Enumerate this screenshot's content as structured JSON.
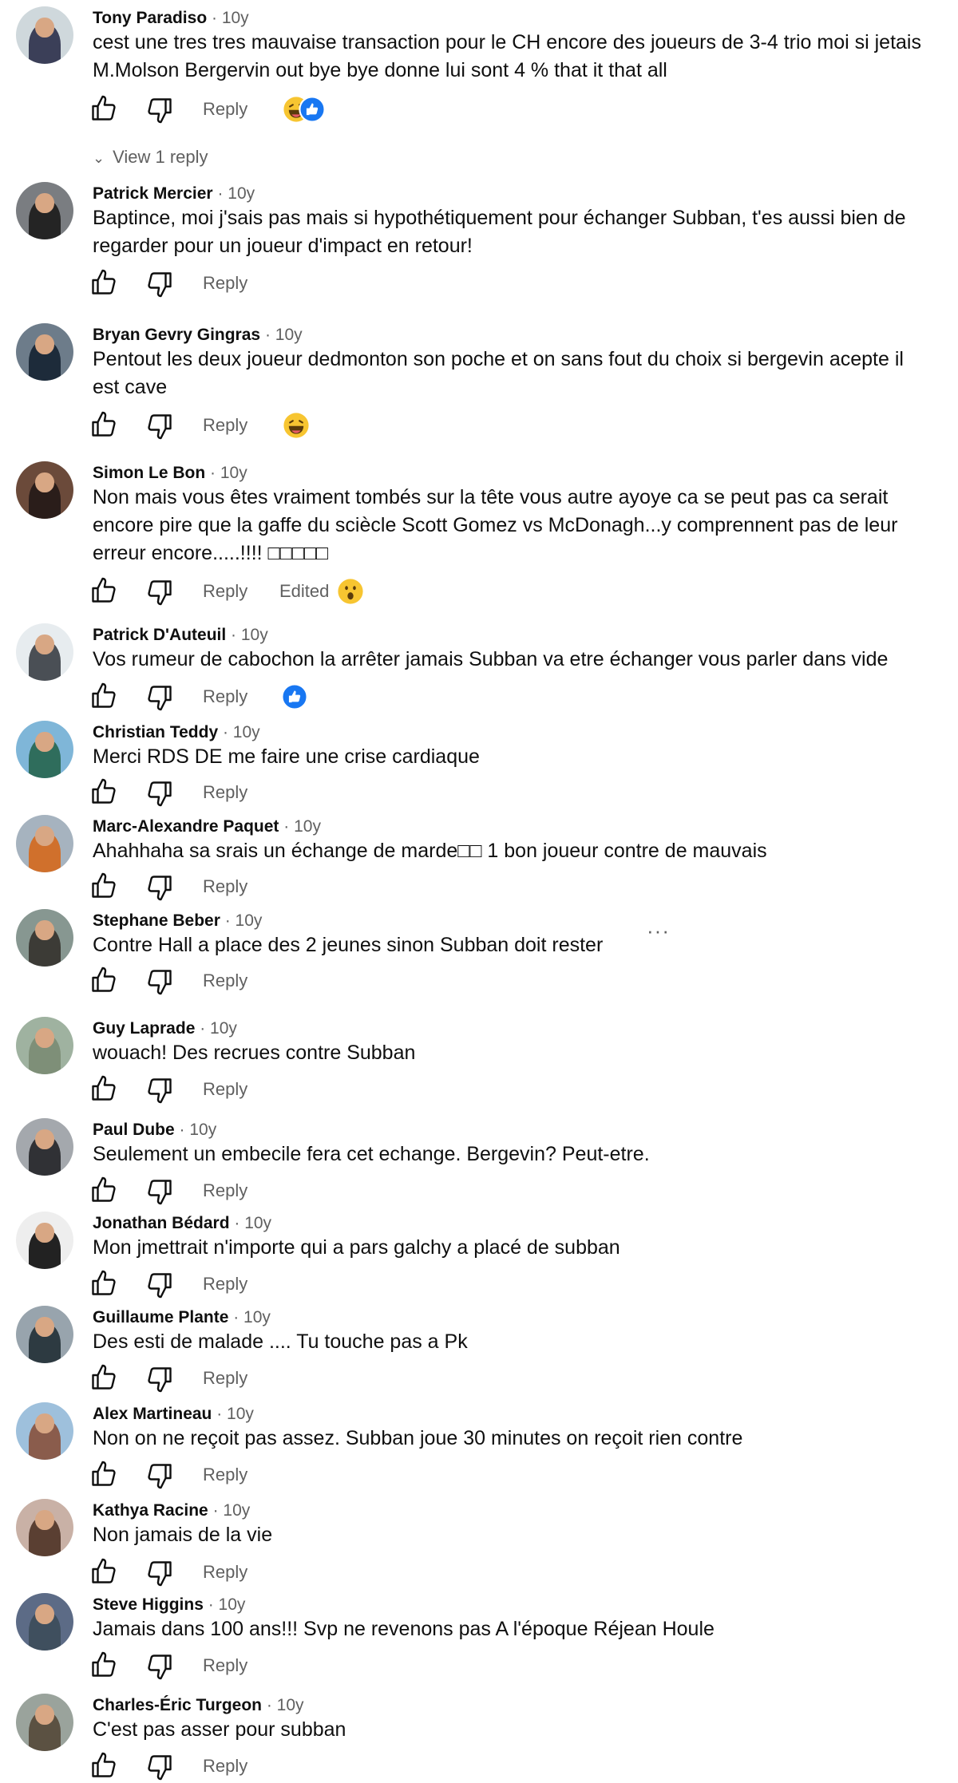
{
  "reply_label": "Reply",
  "comments": [
    {
      "author": "Tony Paradiso",
      "time": "· 10y",
      "text": "cest une tres tres mauvaise transaction pour le CH encore des joueurs de 3-4 trio moi si jetais M.Molson Bergervin out bye bye donne lui sont 4 % that it that all",
      "reactions": [
        "laugh-emoji",
        "like-badge"
      ],
      "view_replies": "View 1 reply"
    },
    {
      "author": "Patrick Mercier",
      "time": "· 10y",
      "text": "Baptince, moi j'sais pas mais si hypothétiquement pour échanger Subban, t'es aussi bien de regarder pour un joueur d'impact en retour!"
    },
    {
      "author": "Bryan Gevry Gingras",
      "time": "· 10y",
      "text": "Pentout les deux joueur dedmonton son poche et on sans fout du choix si bergevin acepte il est cave",
      "reactions": [
        "laugh-emoji"
      ]
    },
    {
      "author": "Simon Le Bon",
      "time": "· 10y",
      "text": "Non mais vous êtes vraiment tombés sur la tête vous autre ayoye ca se peut pas ca serait encore pire que la gaffe du sciècle Scott Gomez vs McDonagh...y comprennent pas de leur erreur encore.....!!!! □□□□□",
      "edited": "Edited",
      "reactions": [
        "wow-emoji"
      ]
    },
    {
      "author": "Patrick D'Auteuil",
      "time": "· 10y",
      "text": "Vos rumeur de cabochon la arrêter jamais Subban va etre échanger vous parler dans vide",
      "reactions": [
        "like-badge"
      ]
    },
    {
      "author": "Christian Teddy",
      "time": "· 10y",
      "text": "Merci RDS DE me faire une crise cardiaque"
    },
    {
      "author": "Marc-Alexandre Paquet",
      "time": "· 10y",
      "text": "Ahahhaha sa srais un échange de marde□□ 1 bon joueur contre de mauvais"
    },
    {
      "author": "Stephane Beber",
      "time": "· 10y",
      "text": "Contre Hall a place des 2 jeunes sinon Subban doit rester",
      "more": "···"
    },
    {
      "author": "Guy Laprade",
      "time": "· 10y",
      "text": "wouach! Des recrues contre Subban"
    },
    {
      "author": "Paul Dube",
      "time": "· 10y",
      "text": "Seulement un embecile fera cet echange. Bergevin? Peut-etre."
    },
    {
      "author": "Jonathan Bédard",
      "time": "· 10y",
      "text": "Mon jmettrait n'importe qui a pars galchy a placé de subban"
    },
    {
      "author": "Guillaume Plante",
      "time": "· 10y",
      "text": "Des esti de malade .... Tu touche pas a Pk"
    },
    {
      "author": "Alex Martineau",
      "time": "· 10y",
      "text": "Non on ne reçoit pas assez. Subban joue 30 minutes on reçoit rien contre"
    },
    {
      "author": "Kathya Racine",
      "time": "· 10y",
      "text": "Non jamais de la vie"
    },
    {
      "author": "Steve Higgins",
      "time": "· 10y",
      "text": "Jamais dans 100 ans!!! Svp ne revenons pas A l'époque Réjean Houle"
    },
    {
      "author": "Charles-Éric Turgeon",
      "time": "· 10y",
      "text": "C'est pas asser pour subban"
    }
  ],
  "colors": {
    "text": "#0f0f0f",
    "muted": "#606060",
    "like_blue": "#1877f2",
    "emoji_yellow": "#f7c531"
  }
}
